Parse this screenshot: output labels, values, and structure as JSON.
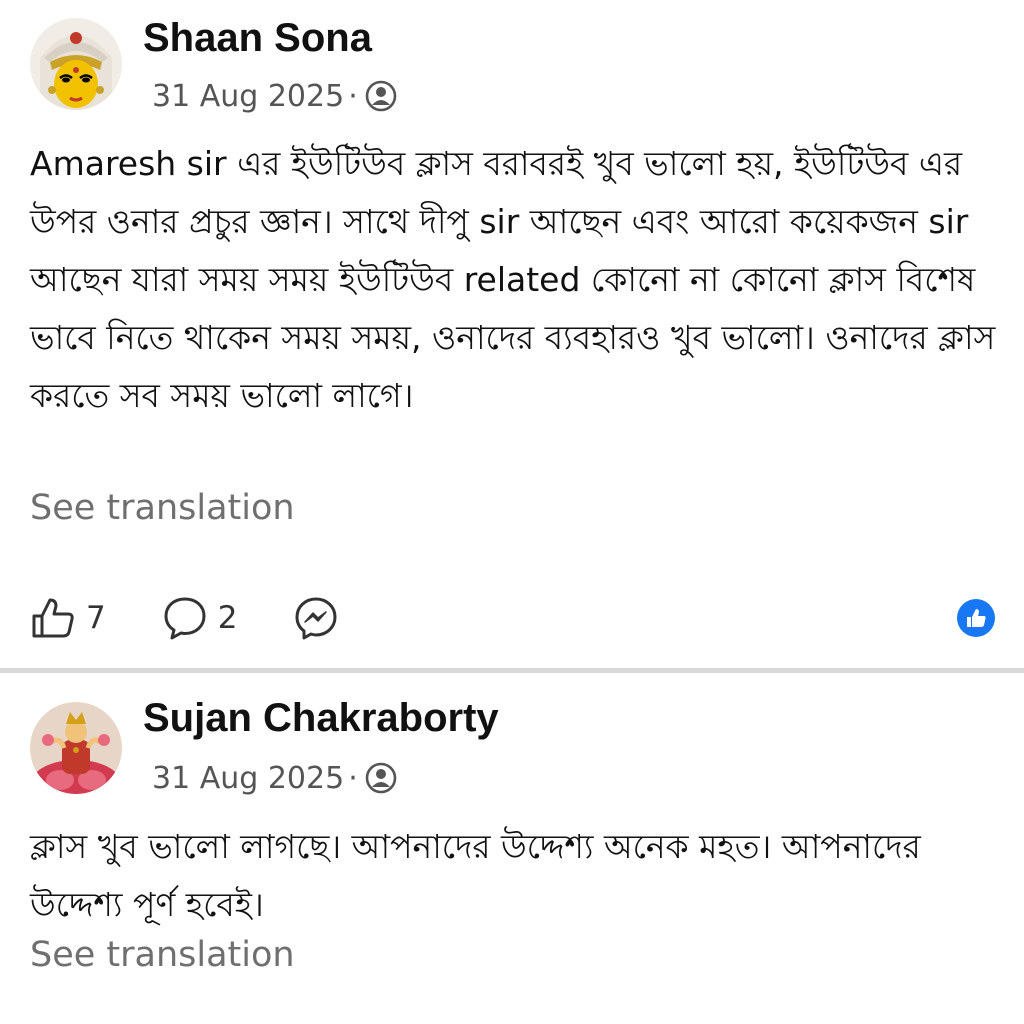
{
  "comments": [
    {
      "author": "Shaan Sona",
      "date": "31 Aug 2025",
      "separator": "·",
      "audience_icon": "friends-audience-icon",
      "avatar": "durga-avatar",
      "text": "Amaresh sir এর ইউটিউব ক্লাস বরাবরই খুব ভালো হয়, ইউটিউব এর উপর ওনার প্রচুর জ্ঞান। সাথে দীপু sir আছেন এবং আরো কয়েকজন sir আছেন যারা সময় সময় ইউটিউব related কোনো না কোনো ক্লাস বিশেষ ভাবে নিতে থাকেন সময় সময়, ওনাদের ব্যবহারও খুব ভালো। ওনাদের ক্লাস করতে সব সময় ভালো লাগে।",
      "see_translation": "See translation",
      "likes": "7",
      "comments": "2",
      "icons": [
        "like-icon",
        "comment-icon",
        "messenger-icon",
        "like-reaction-icon"
      ]
    },
    {
      "author": "Sujan Chakraborty",
      "date": "31 Aug 2025",
      "separator": "·",
      "audience_icon": "friends-audience-icon",
      "avatar": "lakshmi-avatar",
      "text": "ক্লাস খুব ভালো লাগছে। আপনাদের উদ্দেশ্য অনেক মহত। আপনাদের উদ্দেশ্য পূর্ণ হবেই।",
      "see_translation": "See translation"
    }
  ],
  "colors": {
    "text": "#111111",
    "meta": "#555555",
    "translation": "#6f6f6f",
    "divider": "#d9d9d9",
    "reaction_blue": "#1877f2"
  }
}
